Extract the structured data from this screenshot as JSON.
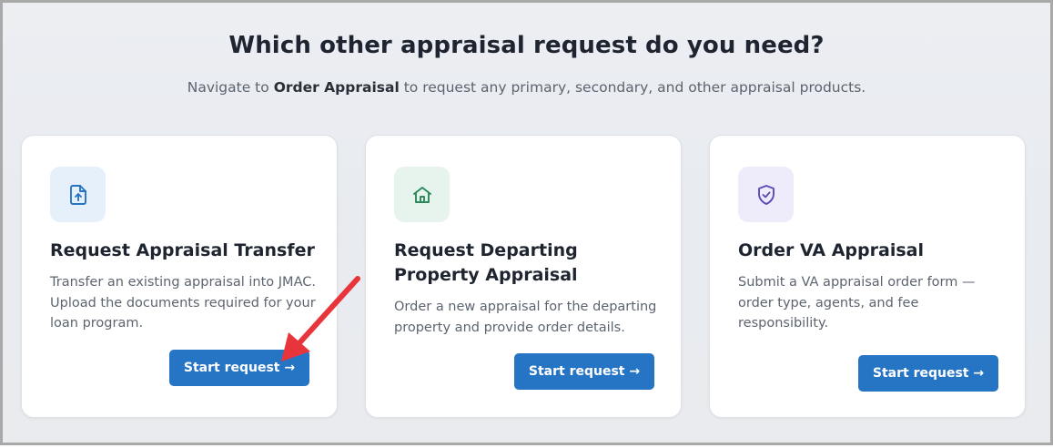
{
  "header": {
    "title": "Which other appraisal request do you need?",
    "subtitle_prefix": "Navigate to",
    "subtitle_link": "Order Appraisal",
    "subtitle_suffix": "to request any primary, secondary, and other appraisal products."
  },
  "cards": [
    {
      "icon": "file-upload-icon",
      "icon_bg": "#e6f0fb",
      "icon_color": "#2674c4",
      "title": "Request Appraisal Transfer",
      "description": "Transfer an existing appraisal into JMAC. Upload the documents required for your loan program.",
      "button": "Start request →"
    },
    {
      "icon": "home-icon",
      "icon_bg": "#e7f4ee",
      "icon_color": "#2a8a5a",
      "title": "Request Departing Property Appraisal",
      "description": "Order a new appraisal for the departing property and provide order details.",
      "button": "Start request →"
    },
    {
      "icon": "shield-check-icon",
      "icon_bg": "#eeecfa",
      "icon_color": "#5a4bb5",
      "title": "Order VA Appraisal",
      "description": "Submit a VA appraisal order form — order type, agents, and fee responsibility.",
      "button": "Start request →"
    }
  ],
  "colors": {
    "primary_button": "#2674c4",
    "annotation_arrow": "#e8353b"
  }
}
